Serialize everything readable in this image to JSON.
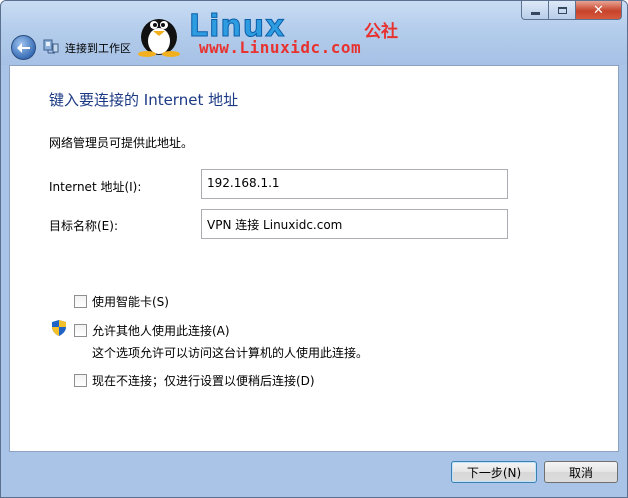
{
  "window": {
    "title": "连接到工作区"
  },
  "watermark": {
    "word": "Linux",
    "cn": "公社",
    "url": "www.Linuxidc.com"
  },
  "page": {
    "heading": "键入要连接的 Internet 地址",
    "intro": "网络管理员可提供此地址。",
    "address_label": "Internet 地址(I):",
    "address_value": "192.168.1.1",
    "destination_label": "目标名称(E):",
    "destination_value": "VPN 连接 Linuxidc.com"
  },
  "options": {
    "smart_card": {
      "label": "使用智能卡(S)",
      "checked": false
    },
    "allow_others": {
      "label": "允许其他人使用此连接(A)",
      "checked": false,
      "description": "这个选项允许可以访问这台计算机的人使用此连接。"
    },
    "connect_later": {
      "label": "现在不连接；仅进行设置以便稍后连接(D)",
      "checked": false
    }
  },
  "buttons": {
    "next": "下一步(N)",
    "cancel": "取消"
  },
  "icons": {
    "back": "back-arrow-icon",
    "network": "network-icon",
    "shield": "uac-shield-icon",
    "minimize": "minimize-icon",
    "maximize": "maximize-icon",
    "close": "close-icon"
  },
  "colors": {
    "heading": "#1c3a84",
    "frame": "#a9c4e6"
  }
}
